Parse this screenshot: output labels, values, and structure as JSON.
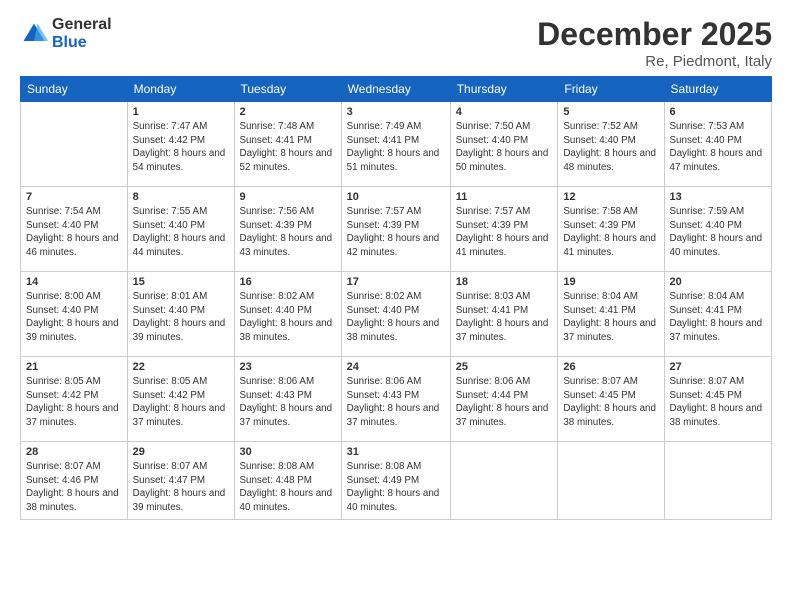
{
  "logo": {
    "general": "General",
    "blue": "Blue"
  },
  "title": {
    "month_year": "December 2025",
    "location": "Re, Piedmont, Italy"
  },
  "weekdays": [
    "Sunday",
    "Monday",
    "Tuesday",
    "Wednesday",
    "Thursday",
    "Friday",
    "Saturday"
  ],
  "weeks": [
    [
      {
        "day": "",
        "sunrise": "",
        "sunset": "",
        "daylight": ""
      },
      {
        "day": "1",
        "sunrise": "Sunrise: 7:47 AM",
        "sunset": "Sunset: 4:42 PM",
        "daylight": "Daylight: 8 hours and 54 minutes."
      },
      {
        "day": "2",
        "sunrise": "Sunrise: 7:48 AM",
        "sunset": "Sunset: 4:41 PM",
        "daylight": "Daylight: 8 hours and 52 minutes."
      },
      {
        "day": "3",
        "sunrise": "Sunrise: 7:49 AM",
        "sunset": "Sunset: 4:41 PM",
        "daylight": "Daylight: 8 hours and 51 minutes."
      },
      {
        "day": "4",
        "sunrise": "Sunrise: 7:50 AM",
        "sunset": "Sunset: 4:40 PM",
        "daylight": "Daylight: 8 hours and 50 minutes."
      },
      {
        "day": "5",
        "sunrise": "Sunrise: 7:52 AM",
        "sunset": "Sunset: 4:40 PM",
        "daylight": "Daylight: 8 hours and 48 minutes."
      },
      {
        "day": "6",
        "sunrise": "Sunrise: 7:53 AM",
        "sunset": "Sunset: 4:40 PM",
        "daylight": "Daylight: 8 hours and 47 minutes."
      }
    ],
    [
      {
        "day": "7",
        "sunrise": "Sunrise: 7:54 AM",
        "sunset": "Sunset: 4:40 PM",
        "daylight": "Daylight: 8 hours and 46 minutes."
      },
      {
        "day": "8",
        "sunrise": "Sunrise: 7:55 AM",
        "sunset": "Sunset: 4:40 PM",
        "daylight": "Daylight: 8 hours and 44 minutes."
      },
      {
        "day": "9",
        "sunrise": "Sunrise: 7:56 AM",
        "sunset": "Sunset: 4:39 PM",
        "daylight": "Daylight: 8 hours and 43 minutes."
      },
      {
        "day": "10",
        "sunrise": "Sunrise: 7:57 AM",
        "sunset": "Sunset: 4:39 PM",
        "daylight": "Daylight: 8 hours and 42 minutes."
      },
      {
        "day": "11",
        "sunrise": "Sunrise: 7:57 AM",
        "sunset": "Sunset: 4:39 PM",
        "daylight": "Daylight: 8 hours and 41 minutes."
      },
      {
        "day": "12",
        "sunrise": "Sunrise: 7:58 AM",
        "sunset": "Sunset: 4:39 PM",
        "daylight": "Daylight: 8 hours and 41 minutes."
      },
      {
        "day": "13",
        "sunrise": "Sunrise: 7:59 AM",
        "sunset": "Sunset: 4:40 PM",
        "daylight": "Daylight: 8 hours and 40 minutes."
      }
    ],
    [
      {
        "day": "14",
        "sunrise": "Sunrise: 8:00 AM",
        "sunset": "Sunset: 4:40 PM",
        "daylight": "Daylight: 8 hours and 39 minutes."
      },
      {
        "day": "15",
        "sunrise": "Sunrise: 8:01 AM",
        "sunset": "Sunset: 4:40 PM",
        "daylight": "Daylight: 8 hours and 39 minutes."
      },
      {
        "day": "16",
        "sunrise": "Sunrise: 8:02 AM",
        "sunset": "Sunset: 4:40 PM",
        "daylight": "Daylight: 8 hours and 38 minutes."
      },
      {
        "day": "17",
        "sunrise": "Sunrise: 8:02 AM",
        "sunset": "Sunset: 4:40 PM",
        "daylight": "Daylight: 8 hours and 38 minutes."
      },
      {
        "day": "18",
        "sunrise": "Sunrise: 8:03 AM",
        "sunset": "Sunset: 4:41 PM",
        "daylight": "Daylight: 8 hours and 37 minutes."
      },
      {
        "day": "19",
        "sunrise": "Sunrise: 8:04 AM",
        "sunset": "Sunset: 4:41 PM",
        "daylight": "Daylight: 8 hours and 37 minutes."
      },
      {
        "day": "20",
        "sunrise": "Sunrise: 8:04 AM",
        "sunset": "Sunset: 4:41 PM",
        "daylight": "Daylight: 8 hours and 37 minutes."
      }
    ],
    [
      {
        "day": "21",
        "sunrise": "Sunrise: 8:05 AM",
        "sunset": "Sunset: 4:42 PM",
        "daylight": "Daylight: 8 hours and 37 minutes."
      },
      {
        "day": "22",
        "sunrise": "Sunrise: 8:05 AM",
        "sunset": "Sunset: 4:42 PM",
        "daylight": "Daylight: 8 hours and 37 minutes."
      },
      {
        "day": "23",
        "sunrise": "Sunrise: 8:06 AM",
        "sunset": "Sunset: 4:43 PM",
        "daylight": "Daylight: 8 hours and 37 minutes."
      },
      {
        "day": "24",
        "sunrise": "Sunrise: 8:06 AM",
        "sunset": "Sunset: 4:43 PM",
        "daylight": "Daylight: 8 hours and 37 minutes."
      },
      {
        "day": "25",
        "sunrise": "Sunrise: 8:06 AM",
        "sunset": "Sunset: 4:44 PM",
        "daylight": "Daylight: 8 hours and 37 minutes."
      },
      {
        "day": "26",
        "sunrise": "Sunrise: 8:07 AM",
        "sunset": "Sunset: 4:45 PM",
        "daylight": "Daylight: 8 hours and 38 minutes."
      },
      {
        "day": "27",
        "sunrise": "Sunrise: 8:07 AM",
        "sunset": "Sunset: 4:45 PM",
        "daylight": "Daylight: 8 hours and 38 minutes."
      }
    ],
    [
      {
        "day": "28",
        "sunrise": "Sunrise: 8:07 AM",
        "sunset": "Sunset: 4:46 PM",
        "daylight": "Daylight: 8 hours and 38 minutes."
      },
      {
        "day": "29",
        "sunrise": "Sunrise: 8:07 AM",
        "sunset": "Sunset: 4:47 PM",
        "daylight": "Daylight: 8 hours and 39 minutes."
      },
      {
        "day": "30",
        "sunrise": "Sunrise: 8:08 AM",
        "sunset": "Sunset: 4:48 PM",
        "daylight": "Daylight: 8 hours and 40 minutes."
      },
      {
        "day": "31",
        "sunrise": "Sunrise: 8:08 AM",
        "sunset": "Sunset: 4:49 PM",
        "daylight": "Daylight: 8 hours and 40 minutes."
      },
      {
        "day": "",
        "sunrise": "",
        "sunset": "",
        "daylight": ""
      },
      {
        "day": "",
        "sunrise": "",
        "sunset": "",
        "daylight": ""
      },
      {
        "day": "",
        "sunrise": "",
        "sunset": "",
        "daylight": ""
      }
    ]
  ]
}
